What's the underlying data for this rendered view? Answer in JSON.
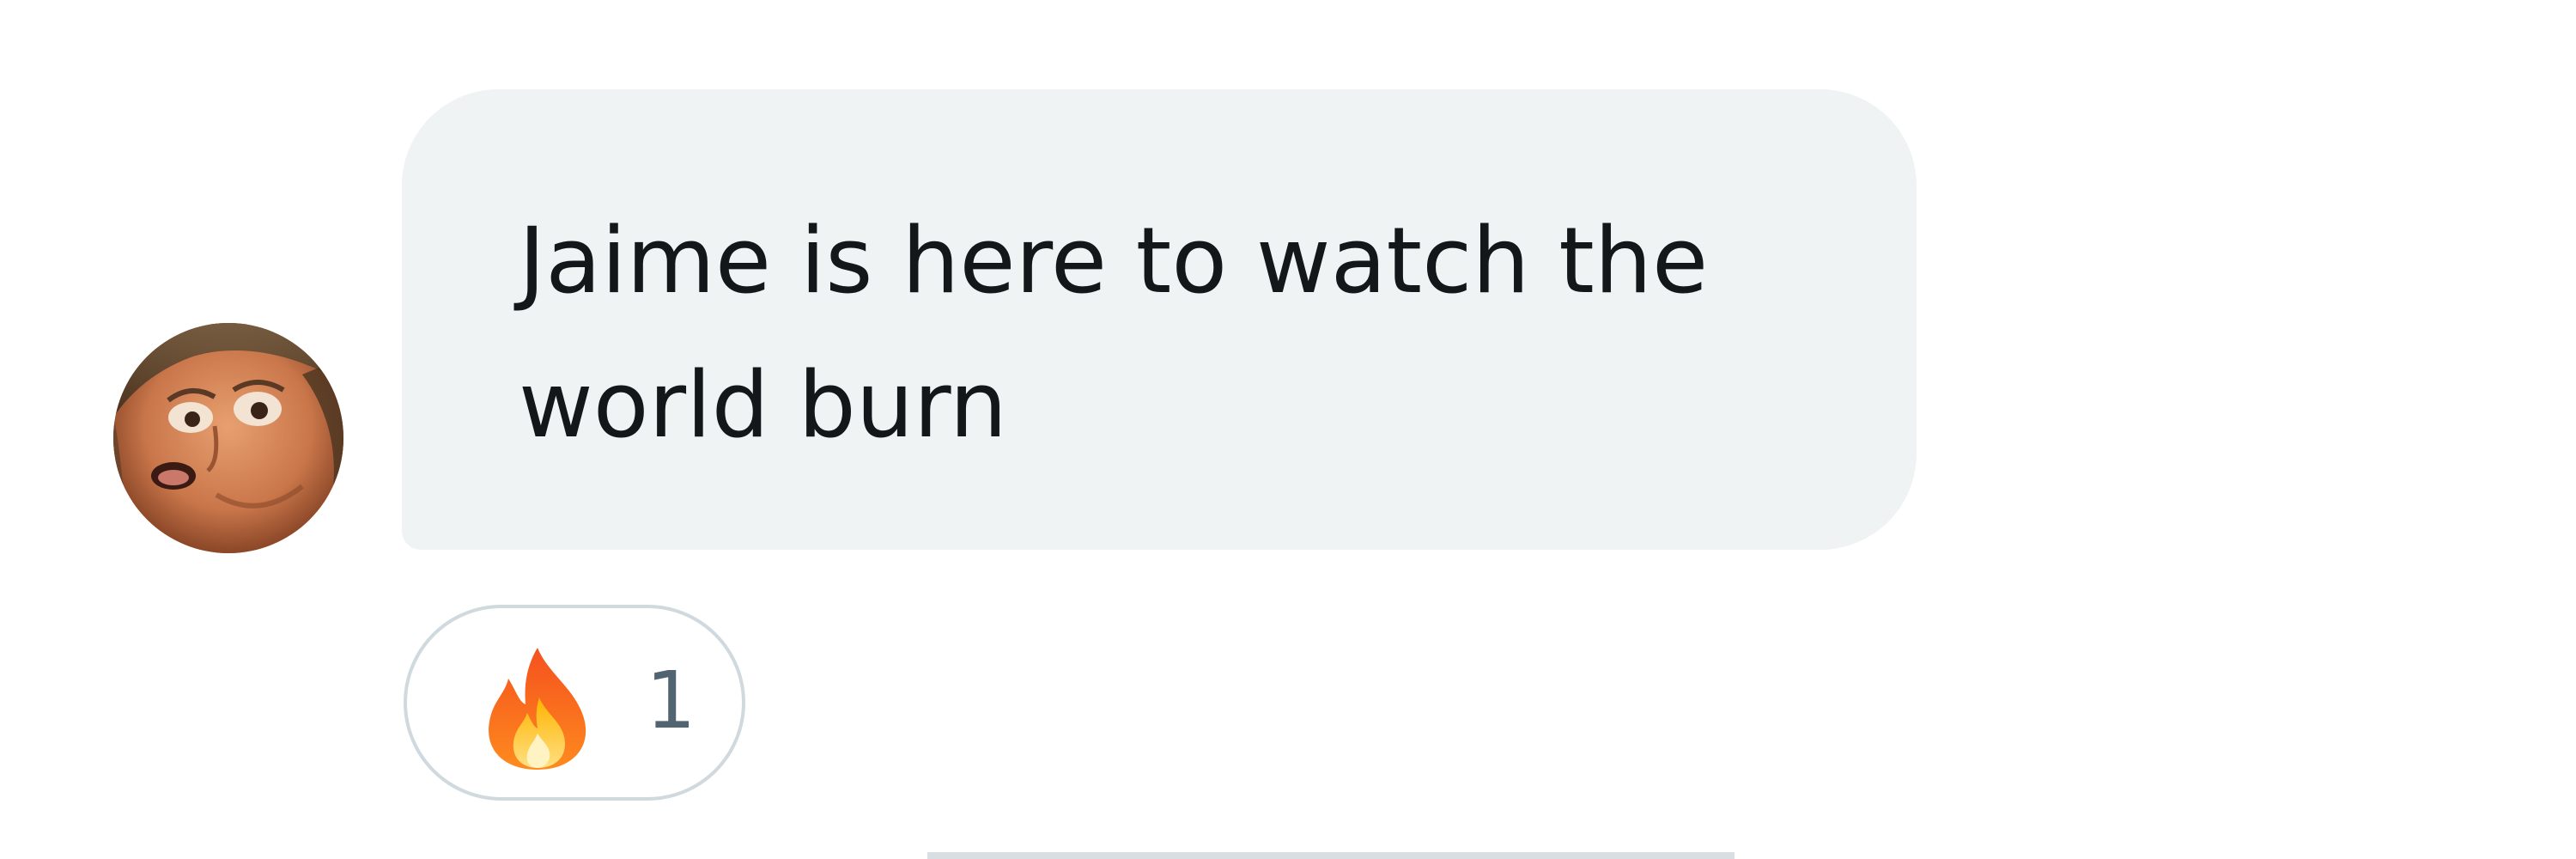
{
  "message": {
    "text": "Jaime is here to watch the world burn",
    "line1": "Jaime is here to watch the",
    "line2": "world burn",
    "bubble_color": "#eff3f4",
    "text_color": "#14171a"
  },
  "reaction": {
    "emoji_icon": "fire-icon",
    "count": "1",
    "border_color": "#cfd9de",
    "count_color": "#536471"
  },
  "avatar": {
    "icon": "avatar-image"
  }
}
